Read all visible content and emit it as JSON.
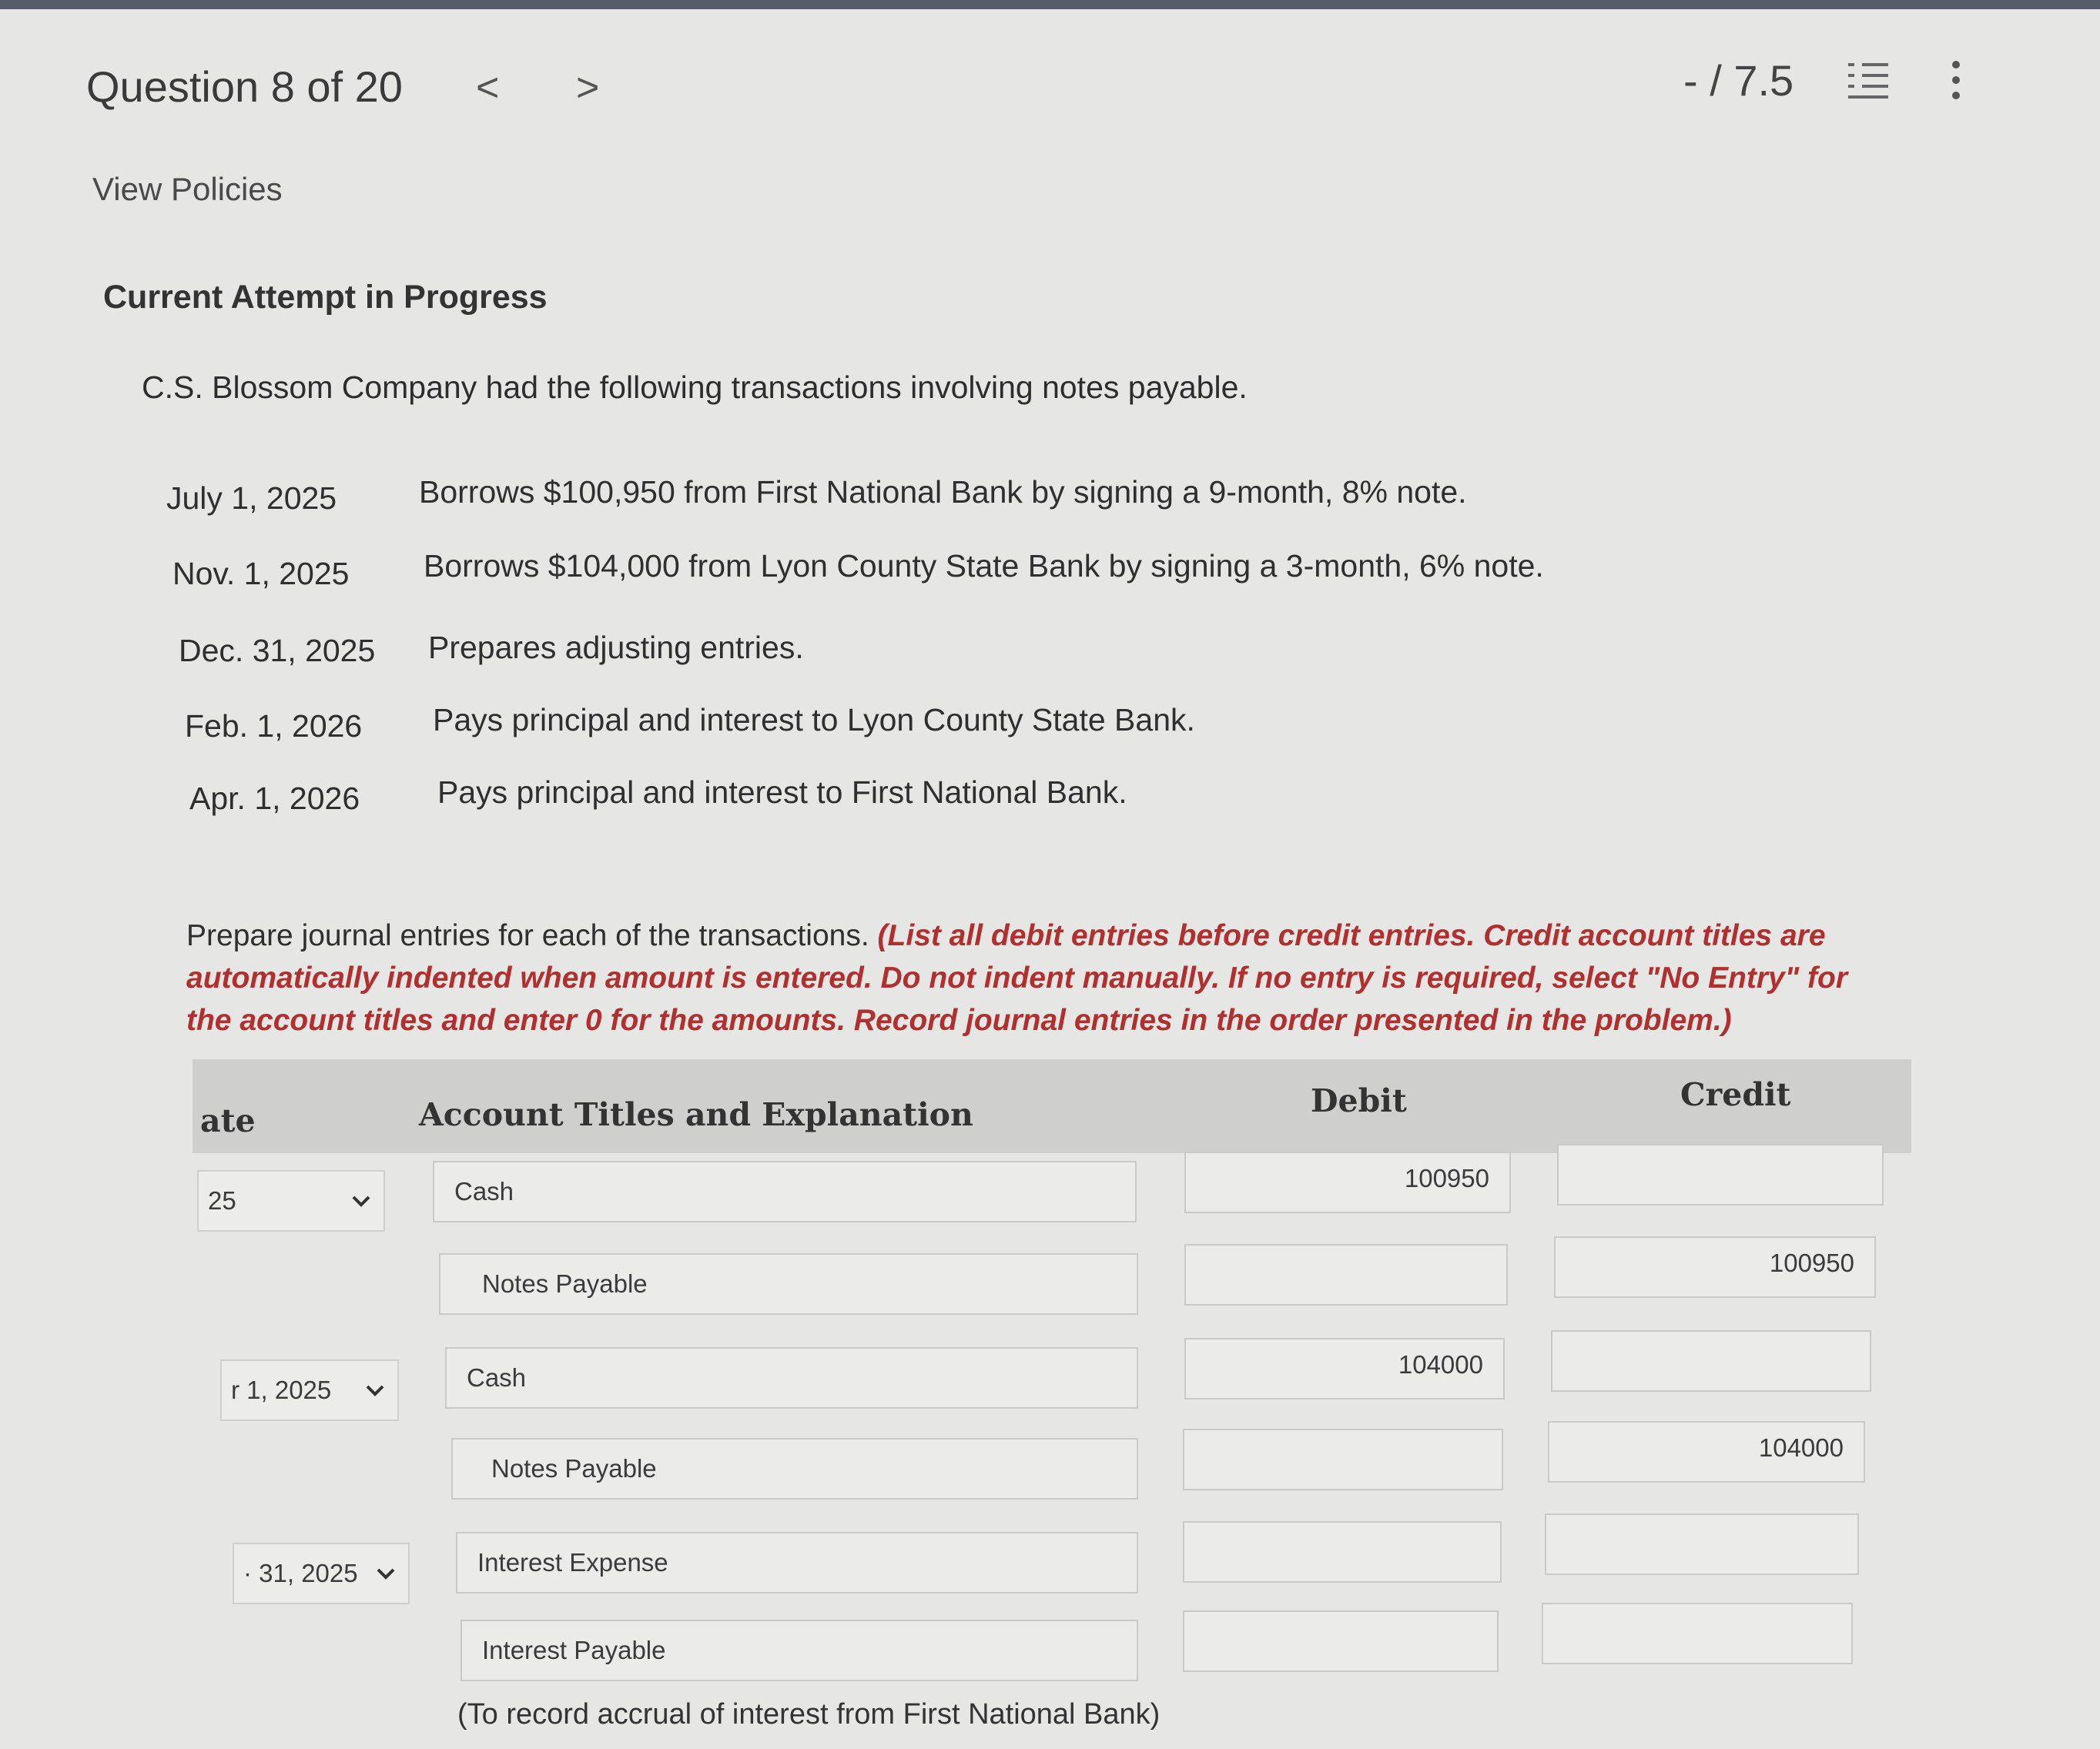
{
  "header": {
    "question_label": "Question 8 of 20",
    "prev_glyph": "<",
    "next_glyph": ">",
    "score": "- / 7.5"
  },
  "links": {
    "view_policies": "View Policies"
  },
  "attempt_status": "Current Attempt in Progress",
  "problem": {
    "intro": "C.S. Blossom Company had the following transactions involving notes payable.",
    "transactions": [
      {
        "date": "July 1, 2025",
        "description": "Borrows $100,950 from First National Bank by signing a 9-month, 8% note."
      },
      {
        "date": "Nov. 1, 2025",
        "description": "Borrows $104,000 from Lyon County State Bank by signing a 3-month, 6% note."
      },
      {
        "date": "Dec. 31, 2025",
        "description": "Prepares adjusting entries."
      },
      {
        "date": "Feb. 1, 2026",
        "description": "Pays principal and interest to Lyon County State Bank."
      },
      {
        "date": "Apr. 1, 2026",
        "description": "Pays principal and interest to First National Bank."
      }
    ],
    "instruction": "Prepare journal entries for each of the transactions.",
    "instruction_note": "(List all debit entries before credit entries. Credit account titles are automatically indented when amount is entered. Do not indent manually. If no entry is required, select \"No Entry\" for the account titles and enter 0 for the amounts. Record journal entries in the order presented in the problem.)"
  },
  "table": {
    "headers": {
      "date": "ate",
      "account": "Account Titles and Explanation",
      "debit": "Debit",
      "credit": "Credit"
    },
    "rows": [
      {
        "date": "25",
        "account": "Cash",
        "debit": "100950",
        "credit": ""
      },
      {
        "date": "",
        "account": "Notes Payable",
        "debit": "",
        "credit": "100950"
      },
      {
        "date": "r 1, 2025",
        "account": "Cash",
        "debit": "104000",
        "credit": ""
      },
      {
        "date": "",
        "account": "Notes Payable",
        "debit": "",
        "credit": "104000"
      },
      {
        "date": "· 31, 2025",
        "account": "Interest Expense",
        "debit": "",
        "credit": ""
      },
      {
        "date": "",
        "account": "Interest Payable",
        "debit": "",
        "credit": ""
      }
    ],
    "explanation": "(To record accrual of interest from First National Bank)"
  },
  "icons": {
    "list": "list-check-icon",
    "more": "more-vertical-icon",
    "dropdown": "chevron-down-icon"
  }
}
